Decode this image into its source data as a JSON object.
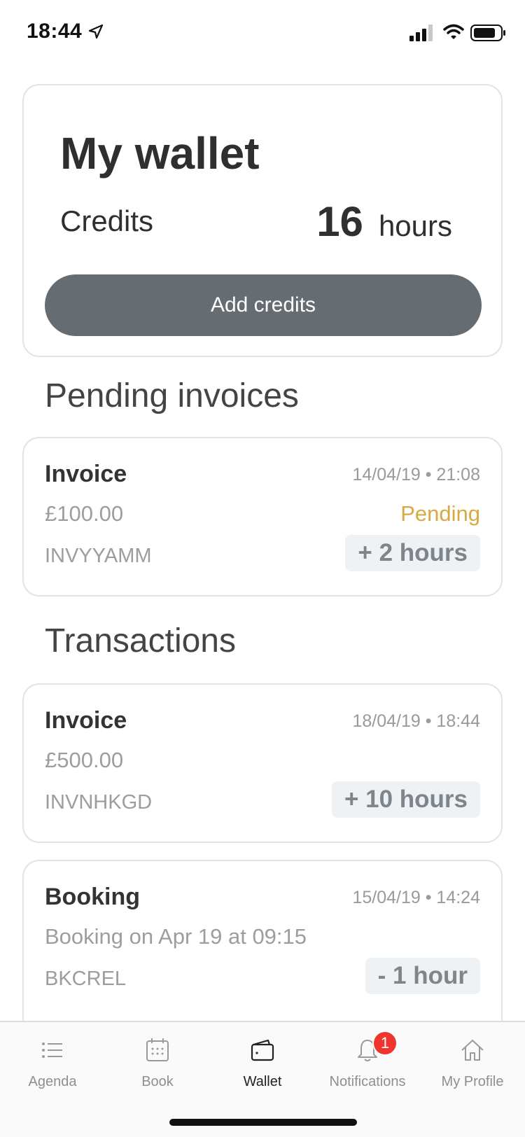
{
  "status_bar": {
    "time": "18:44"
  },
  "wallet": {
    "title": "My wallet",
    "credits_label": "Credits",
    "credits_number": "16",
    "credits_unit": "hours",
    "add_credits_label": "Add credits"
  },
  "pending": {
    "title": "Pending invoices",
    "items": [
      {
        "title": "Invoice",
        "date": "14/04/19 • 21:08",
        "amount": "£100.00",
        "status": "Pending",
        "ref": "INVYYAMM",
        "hours": "+ 2 hours"
      }
    ]
  },
  "transactions": {
    "title": "Transactions",
    "items": [
      {
        "title": "Invoice",
        "date": "18/04/19 • 18:44",
        "amount": "£500.00",
        "ref": "INVNHKGD",
        "hours": "+ 10 hours"
      },
      {
        "title": "Booking",
        "date": "15/04/19 • 14:24",
        "amount": "Booking on Apr 19 at 09:15",
        "ref": "BKCREL",
        "hours": "- 1 hour"
      }
    ]
  },
  "tabs": [
    {
      "label": "Agenda",
      "icon": "list-icon"
    },
    {
      "label": "Book",
      "icon": "calendar-icon"
    },
    {
      "label": "Wallet",
      "icon": "wallet-icon"
    },
    {
      "label": "Notifications",
      "icon": "bell-icon",
      "badge": "1"
    },
    {
      "label": "My Profile",
      "icon": "home-icon"
    }
  ],
  "active_tab": "Wallet",
  "colors": {
    "button": "#656c72",
    "pending": "#d8aa43",
    "badge": "#f0352e"
  }
}
